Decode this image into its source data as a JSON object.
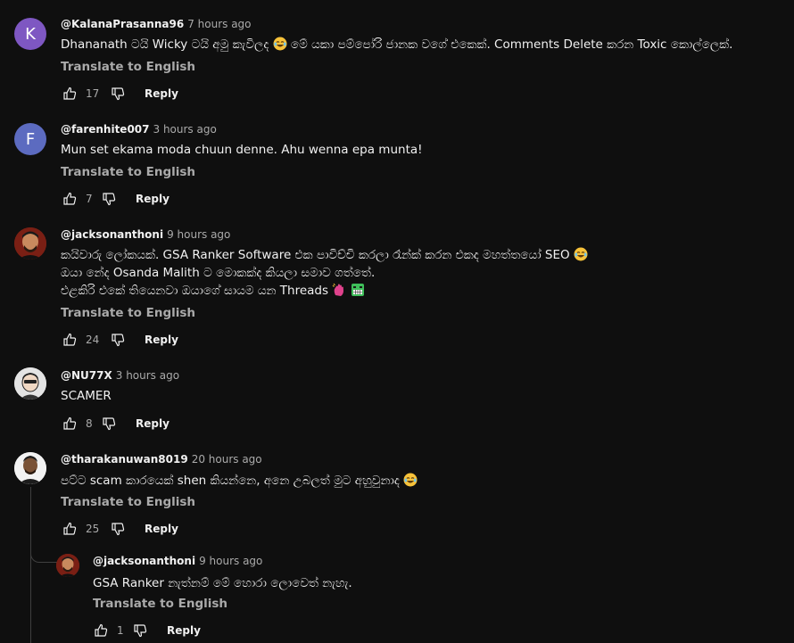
{
  "ui": {
    "translate_label": "Translate to English",
    "reply_label": "Reply"
  },
  "comments": [
    {
      "author": "@KalanaPrasanna96",
      "time": "7 hours ago",
      "avatar_letter": "K",
      "avatar_color": "#7e57c2",
      "text_line1": "Dhananath ටයි Wicky ටයි අමු කැවිලද ",
      "text_line1_after": " මේ යකා පම්පෝරි ජානක වගේ එකෙක්. Comments Delete කරන Toxic කොල්ලෙක්.",
      "likes": "17"
    },
    {
      "author": "@farenhite007",
      "time": "3 hours ago",
      "avatar_letter": "F",
      "avatar_color": "#5c6bc0",
      "text_line1": "Mun set ekama moda chuun denne. Ahu wenna epa munta!",
      "likes": "7"
    },
    {
      "author": "@jacksonanthoni",
      "time": "9 hours ago",
      "text_line1": "කයිවාරු ලෝකයක්. GSA Ranker Software එක පාවිච්චි කරලා රෑන්ක් කරන එකද මහත්තයෝ SEO ",
      "text_line2": "ඔයා නේද Osanda Malith ට මොකක්ද කියලා සමාව ගත්තේ.",
      "text_line3": "එළකිරි එකේ තියෙනවා ඔයාගේ සායම යන Threads ",
      "likes": "24"
    },
    {
      "author": "@NU77X",
      "time": "3 hours ago",
      "text_line1": "SCAMER",
      "likes": "8"
    },
    {
      "author": "@tharakanuwan8019",
      "time": "20 hours ago",
      "text_line1": "පට්ට scam කාරයෙක් shen කියන්නෙ, අනෙ උබලත් මුට අහුවුනාද ",
      "likes": "25"
    }
  ],
  "reply": {
    "author": "@jacksonanthoni",
    "time": "9 hours ago",
    "text_line1": "GSA Ranker නැත්නම් මේ හොරා ලොවෙත් නැහැ.",
    "likes": "1"
  }
}
